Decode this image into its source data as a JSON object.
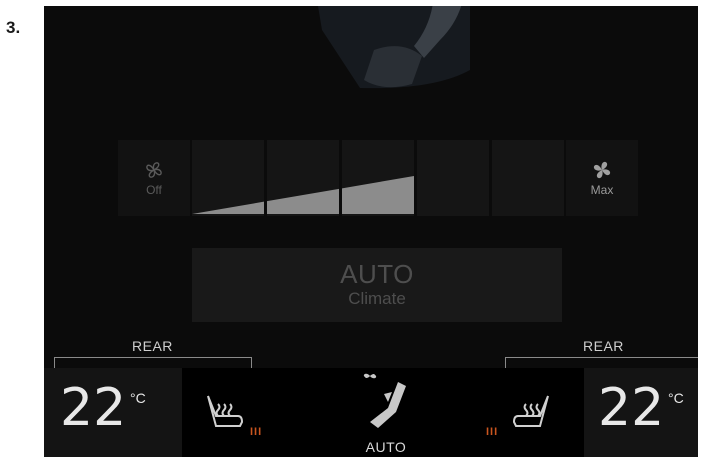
{
  "step": {
    "number": "3."
  },
  "fan": {
    "off_label": "Off",
    "max_label": "Max",
    "level": 3,
    "max_level": 5
  },
  "auto_button": {
    "main": "AUTO",
    "sub": "Climate"
  },
  "rear": {
    "left_label": "REAR",
    "right_label": "REAR"
  },
  "bottom": {
    "left_temp": "22",
    "left_unit": "°C",
    "right_temp": "22",
    "right_unit": "°C",
    "seat_left_heat": "III",
    "seat_right_heat": "III",
    "center_label": "AUTO"
  },
  "colors": {
    "screen_bg": "#0b0b0b",
    "heat_indicator": "#c9551f",
    "fan_fill": "#8c8c8c"
  },
  "icons": {
    "fan_off": "fan-outline-icon",
    "fan_max": "fan-filled-icon",
    "airflow": "airflow-seat-icon",
    "seat_heat": "seat-heating-icon"
  }
}
